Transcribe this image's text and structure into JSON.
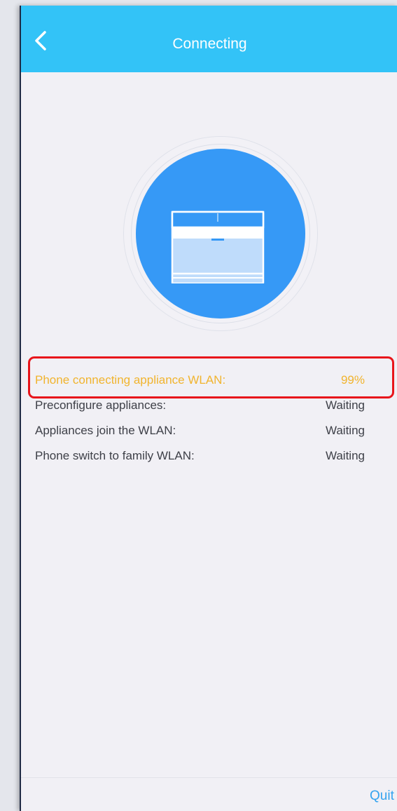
{
  "header": {
    "title": "Connecting",
    "back_icon": "chevron-left-icon"
  },
  "device": {
    "icon": "window-air-conditioner-icon"
  },
  "steps": [
    {
      "label": "Phone connecting appliance WLAN:",
      "status": "99%",
      "progress_percent": 99,
      "state": "active"
    },
    {
      "label": "Preconfigure appliances:",
      "status": "Waiting",
      "state": "waiting"
    },
    {
      "label": "Appliances join the WLAN:",
      "status": "Waiting",
      "state": "waiting"
    },
    {
      "label": "Phone switch to family WLAN:",
      "status": "Waiting",
      "state": "waiting"
    }
  ],
  "footer": {
    "quit_label": "Quit"
  },
  "colors": {
    "header_bg": "#33c3f7",
    "device_circle": "#3699f6",
    "active_step": "#f1b42e",
    "highlight_border": "#e8151b",
    "quit_text": "#33a3ef"
  }
}
